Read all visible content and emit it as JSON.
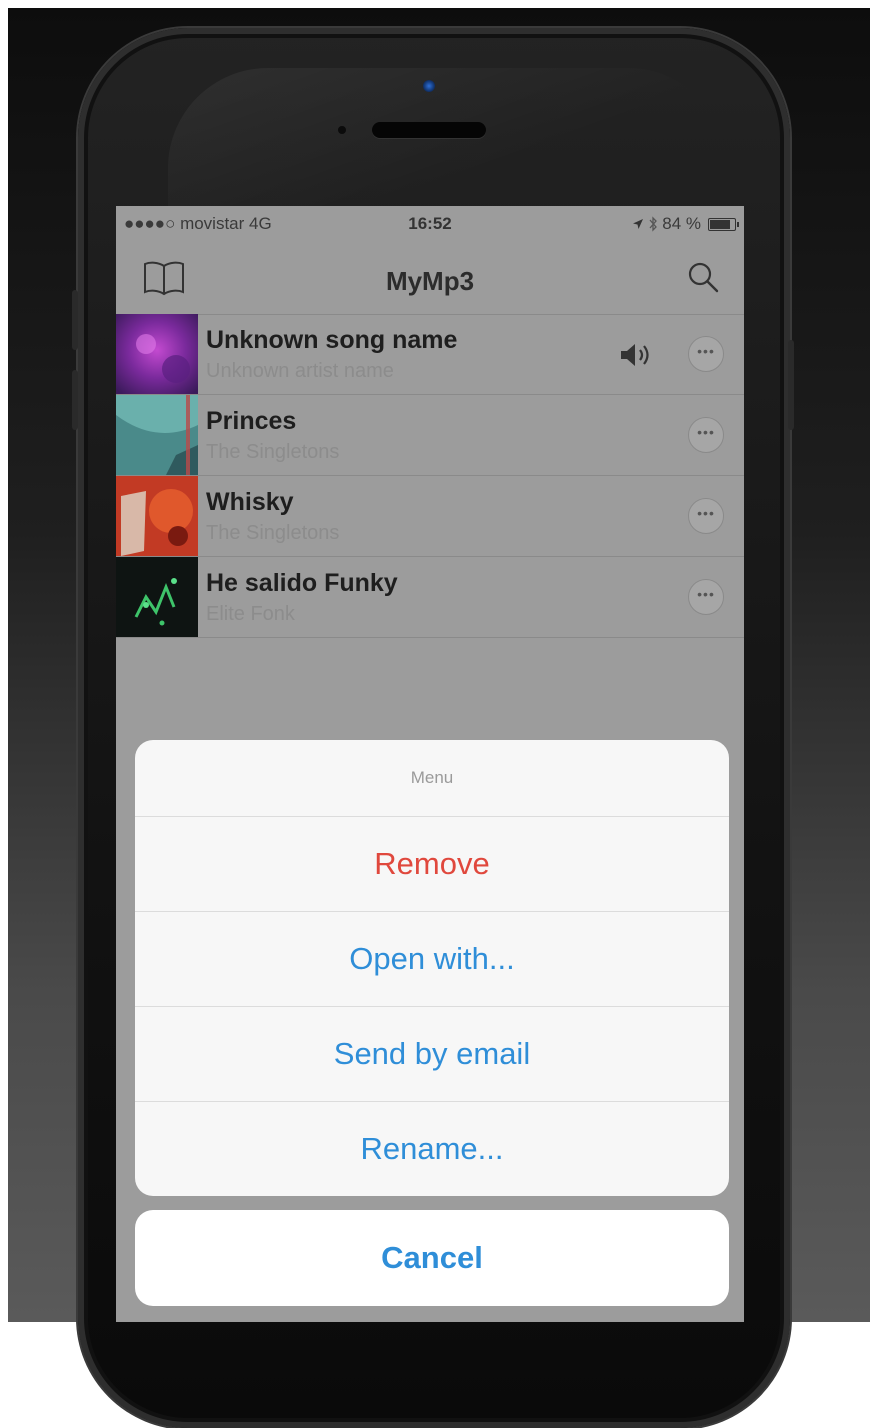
{
  "status_bar": {
    "carrier": "●●●●○ movistar  4G",
    "time": "16:52",
    "battery_text": "84 %"
  },
  "nav": {
    "title": "MyMp3",
    "left_icon": "book-icon",
    "right_icon": "search-icon"
  },
  "songs": [
    {
      "name": "Unknown song name",
      "artist": "Unknown artist name",
      "playing": true
    },
    {
      "name": "Princes",
      "artist": "The Singletons",
      "playing": false
    },
    {
      "name": "Whisky",
      "artist": "The Singletons",
      "playing": false
    },
    {
      "name": "He salido Funky",
      "artist": "Elite Fonk",
      "playing": false
    }
  ],
  "action_sheet": {
    "title": "Menu",
    "actions": [
      {
        "label": "Remove",
        "style": "destructive"
      },
      {
        "label": "Open with...",
        "style": "default"
      },
      {
        "label": "Send by email",
        "style": "default"
      },
      {
        "label": "Rename...",
        "style": "default"
      }
    ],
    "cancel_label": "Cancel"
  },
  "colors": {
    "destructive": "#e0483d",
    "accent": "#2f8ed8"
  }
}
